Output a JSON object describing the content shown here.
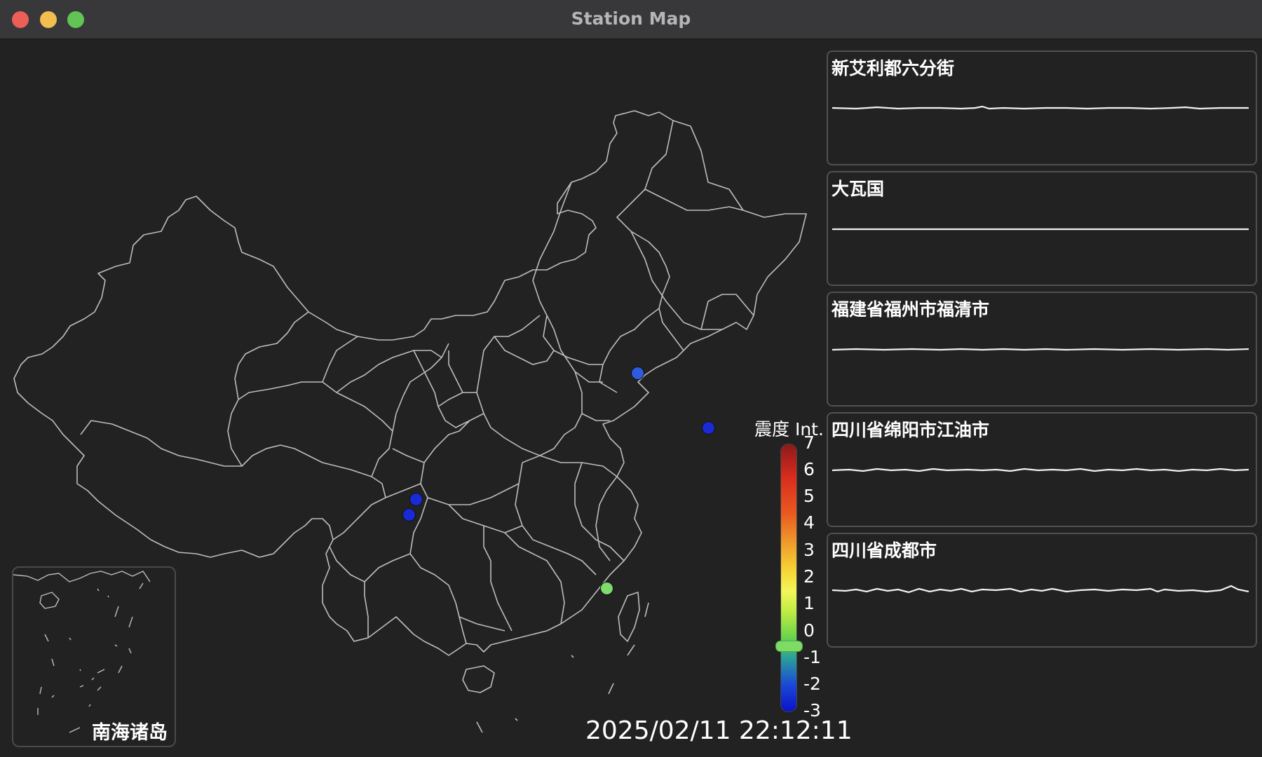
{
  "window": {
    "title": "Station Map"
  },
  "map": {
    "inset_label": "南海诸岛",
    "stations": [
      {
        "name": "station-liaoning",
        "color": "#2f5be0"
      },
      {
        "name": "station-offshore",
        "color": "#1a2ad4"
      },
      {
        "name": "station-sichuan-a",
        "color": "#1a2ad4"
      },
      {
        "name": "station-sichuan-b",
        "color": "#1a2ad4"
      },
      {
        "name": "station-fujian",
        "color": "#7cdc6c"
      }
    ]
  },
  "legend": {
    "title": "震度 Int.",
    "ticks": [
      "7",
      "6",
      "5",
      "4",
      "3",
      "2",
      "1",
      "0",
      "-1",
      "-2",
      "-3"
    ],
    "current_level": 0
  },
  "timestamp": "2025/02/11 22:12:11",
  "panels": [
    {
      "title": "新艾利都六分街"
    },
    {
      "title": "大瓦国"
    },
    {
      "title": "福建省福州市福清市"
    },
    {
      "title": "四川省绵阳市江油市"
    },
    {
      "title": "四川省成都市"
    }
  ]
}
